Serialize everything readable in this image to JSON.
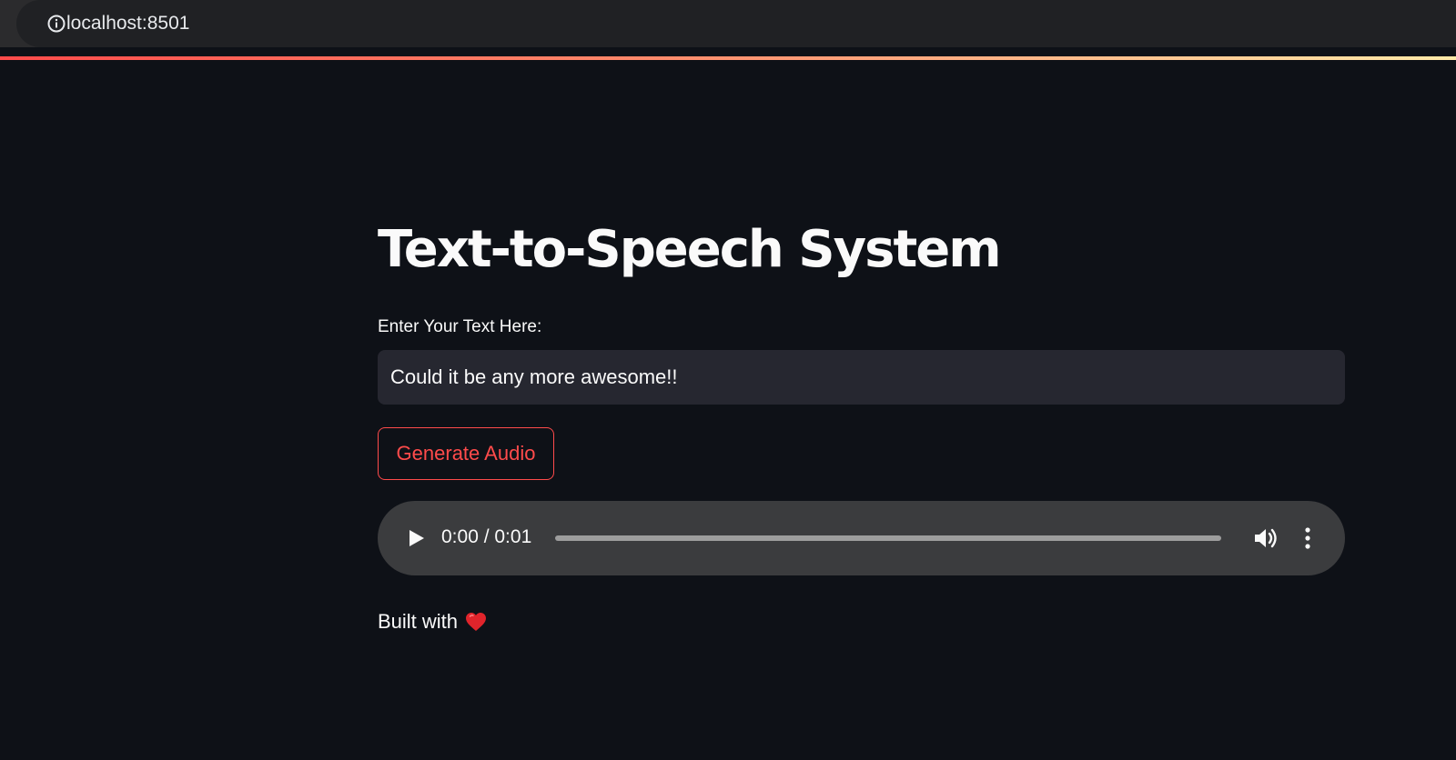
{
  "browser": {
    "url": "localhost:8501",
    "site_info_icon": "info-circle-icon"
  },
  "app": {
    "title": "Text-to-Speech System",
    "input": {
      "label": "Enter Your Text Here:",
      "value": "Could it be any more awesome!!"
    },
    "generate_button_label": "Generate Audio",
    "audio_player": {
      "time_display": "0:00 / 0:01",
      "progress": 0,
      "play_icon": "play-icon",
      "volume_icon": "volume-icon",
      "more_icon": "more-vertical-icon"
    },
    "footer": {
      "text": "Built with",
      "emoji_icon": "red-heart-icon"
    }
  },
  "colors": {
    "background": "#0e1117",
    "accent": "#ff4b4b",
    "input_background": "#262730",
    "player_background": "#3b3c3e",
    "text": "#fafafa"
  }
}
